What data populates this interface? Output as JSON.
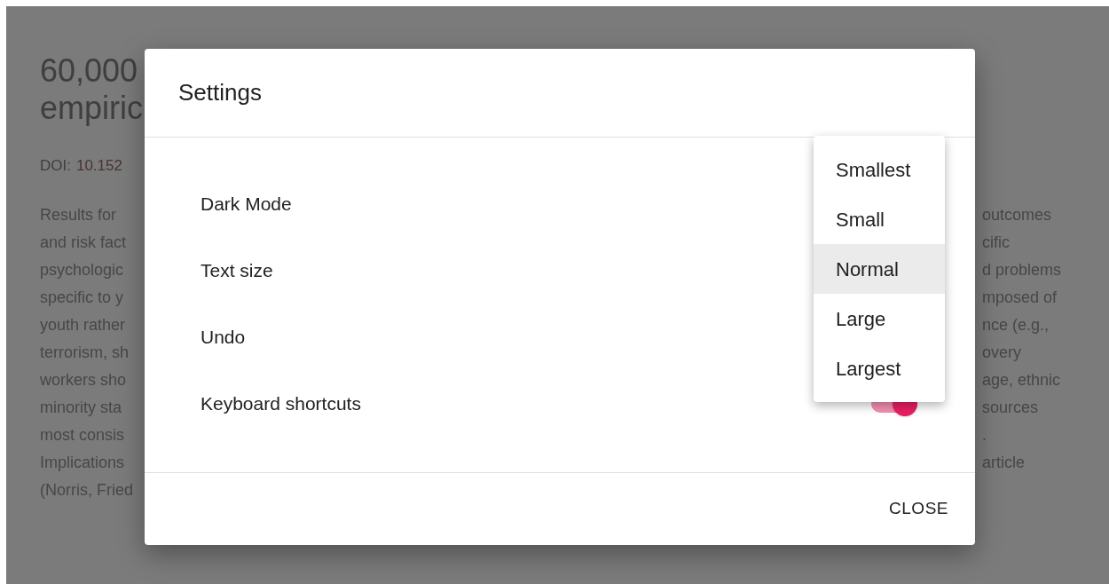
{
  "background": {
    "title_lines": [
      "60,000",
      "empiric"
    ],
    "doi_label": "DOI:",
    "doi_value": "10.152",
    "left_lines": [
      "Results for",
      "and risk fact",
      "psychologic",
      "specific to y",
      "youth rather",
      "terrorism, sh",
      "workers sho",
      "minority sta",
      "most consis",
      "Implications",
      "(Norris, Fried"
    ],
    "right_lines": [
      "outcomes",
      "cific",
      "d problems",
      "mposed of",
      "nce (e.g.,",
      "overy",
      "age, ethnic",
      "sources",
      ".",
      "article"
    ]
  },
  "dialog": {
    "title": "Settings",
    "rows": [
      {
        "label": "Dark Mode",
        "kind": "plain"
      },
      {
        "label": "Text size",
        "kind": "plain"
      },
      {
        "label": "Undo",
        "kind": "plain"
      },
      {
        "label": "Keyboard shortcuts",
        "kind": "toggle",
        "on": true
      }
    ],
    "close": "CLOSE"
  },
  "menu": [
    {
      "label": "Smallest",
      "selected": false
    },
    {
      "label": "Small",
      "selected": false
    },
    {
      "label": "Normal",
      "selected": true
    },
    {
      "label": "Large",
      "selected": false
    },
    {
      "label": "Largest",
      "selected": false
    }
  ]
}
